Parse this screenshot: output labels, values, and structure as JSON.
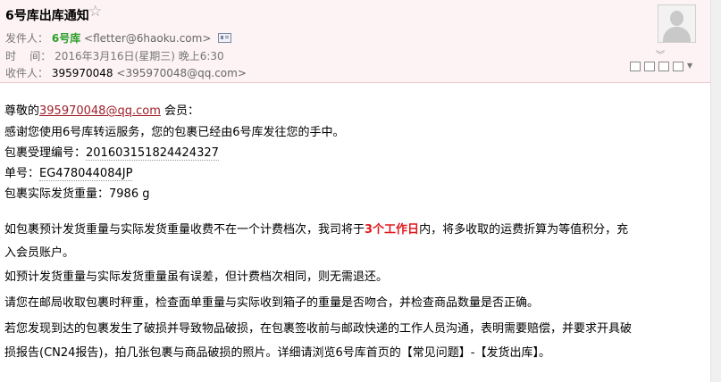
{
  "header": {
    "subject": "6号库出库通知",
    "star_icon": "star-icon",
    "sender_label": "发件人：",
    "sender_name": "6号库",
    "sender_email": "<fletter@6haoku.com>",
    "time_label": "时    间：",
    "time_value": "2016年3月16日(星期三) 晚上6:30",
    "recipient_label": "收件人：",
    "recipient_name": "395970048",
    "recipient_email": "<395970048@qq.com>",
    "expand_icon": "double-chevron-down-icon",
    "toolbar_icons": [
      "new-window-icon",
      "copy-icon",
      "download-icon",
      "print-icon",
      "more-dropdown-icon"
    ]
  },
  "body": {
    "greeting_prefix": "尊敬的",
    "greeting_email": "395970048@qq.com",
    "greeting_suffix": " 会员：",
    "thanks": "感谢您使用6号库转运服务，您的包裹已经由6号库发往您的手中。",
    "package_no_label": "包裹受理编号：",
    "package_no_value": "201603151824424327",
    "tracking_label": "单号：",
    "tracking_value": "EG478044084JP",
    "weight_label": "包裹实际发货重量：",
    "weight_value": "7986 g",
    "para1_a": "如包裹预计发货重量与实际发货重量收费不在一个计费档次，我司将于",
    "para1_highlight": "3个工作日",
    "para1_b": "内，将多收取的运费折算为等值积分，充",
    "para1_c": "入会员账户。",
    "para2": "如预计发货重量与实际发货重量虽有误差，但计费档次相同，则无需退还。",
    "para3": "请您在邮局收取包裹时秤重，检查面单重量与实际收到箱子的重量是否吻合，并检查商品数量是否正确。",
    "para4_a": "若您发现到达的包裹发生了破损并导致物品破损，在包裹签收前与邮政快递的工作人员沟通，表明需要赔偿，并要求开具破",
    "para4_b": "损报告(CN24报告)，拍几张包裹与商品破损的照片。详细请浏览6号库首页的【常见问题】-【发货出库】。"
  }
}
